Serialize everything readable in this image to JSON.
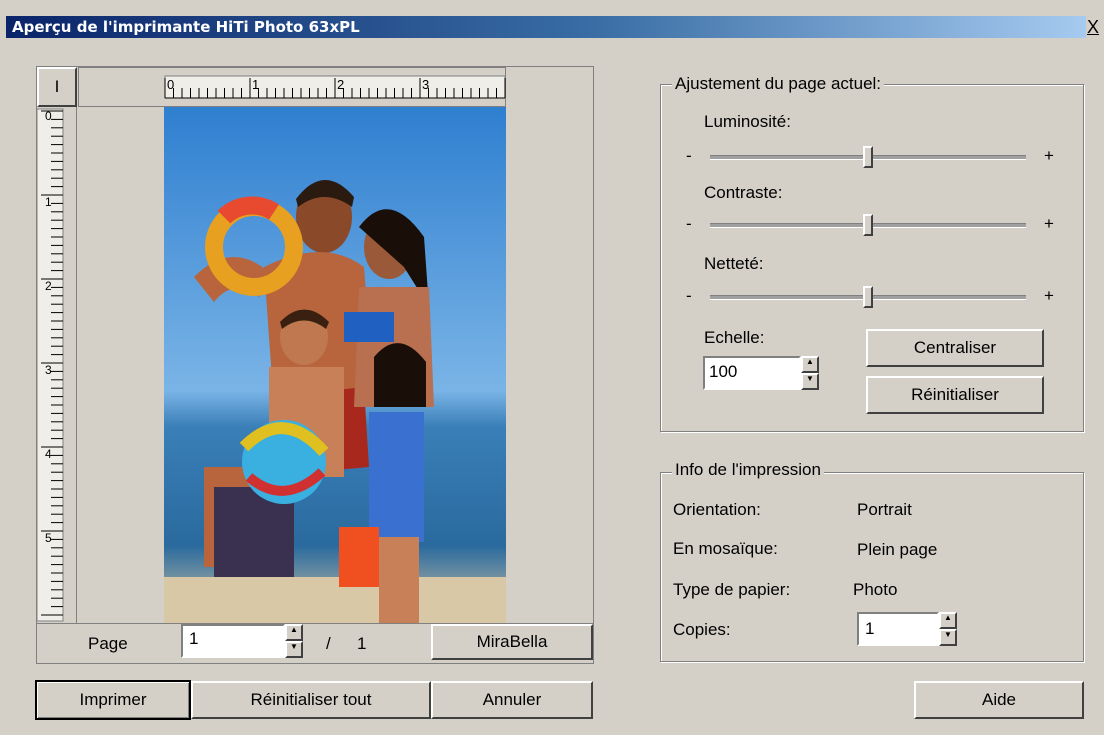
{
  "window": {
    "title": "Aperçu de l'imprimante HiTi Photo 63xPL",
    "close_glyph": "X"
  },
  "ruler": {
    "corner_label": "I",
    "h_labels": [
      "0",
      "1",
      "2",
      "3"
    ],
    "v_labels": [
      "0",
      "1",
      "2",
      "3",
      "4",
      "5"
    ]
  },
  "preview": {
    "image_description_icon": "photo-image"
  },
  "page_bar": {
    "page_label": "Page",
    "page_value": "1",
    "separator": "/",
    "total": "1",
    "mirabella_label": "MiraBella"
  },
  "adjust": {
    "legend": "Ajustement du page actuel:",
    "brightness_label": "Luminosité:",
    "contrast_label": "Contraste:",
    "sharpness_label": "Netteté:",
    "minus": "-",
    "plus": "+",
    "brightness_level": 0.5,
    "contrast_level": 0.5,
    "sharpness_level": 0.5,
    "scale_label": "Echelle:",
    "scale_value": "100",
    "center_label": "Centraliser",
    "reset_label": "Réinitialiser"
  },
  "info": {
    "legend": "Info de l'impression",
    "orientation_label": "Orientation:",
    "orientation_value": "Portrait",
    "mosaic_label": "En mosaïque:",
    "mosaic_value": "Plein page",
    "paper_label": "Type de papier:",
    "paper_value": "Photo",
    "copies_label": "Copies:",
    "copies_value": "1"
  },
  "buttons": {
    "print": "Imprimer",
    "reset_all": "Réinitialiser tout",
    "cancel": "Annuler",
    "help": "Aide"
  }
}
